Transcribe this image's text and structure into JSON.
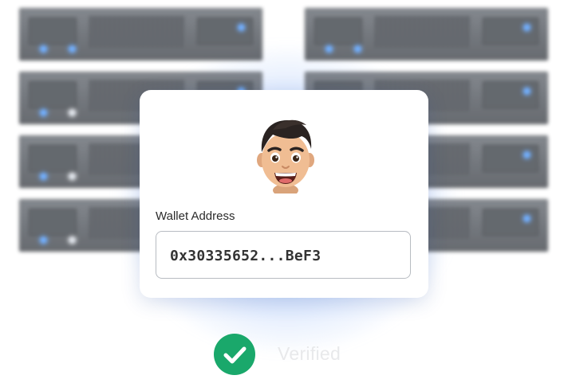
{
  "wallet": {
    "label": "Wallet Address",
    "address": "0x30335652...BeF3"
  },
  "status": {
    "text": "Verified",
    "icon": "check-icon",
    "color": "#1aa86b"
  },
  "avatar": {
    "icon": "memoji-avatar"
  },
  "accent_glow": "#4a82f0"
}
